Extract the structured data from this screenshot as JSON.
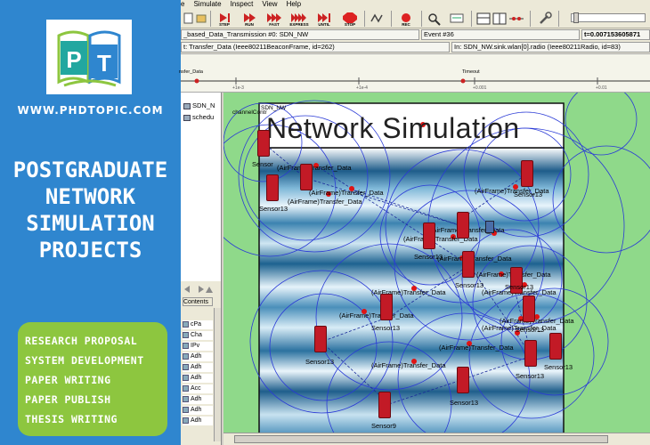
{
  "promo": {
    "logo_text": "PT",
    "website": "WWW.PHDTOPIC.COM",
    "headline": [
      "POSTGRADUATE",
      "NETWORK",
      "SIMULATION",
      "PROJECTS"
    ],
    "services": [
      "RESEARCH PROPOSAL",
      "SYSTEM DEVELOPMENT",
      "PAPER WRITING",
      "PAPER PUBLISH",
      "THESIS WRITING"
    ],
    "colors": {
      "panel": "#2f86cf",
      "services_bg": "#8dc63f",
      "logo_teal": "#22a7a0",
      "logo_blue": "#2f86cf",
      "logo_green": "#8dc63f"
    }
  },
  "menu": [
    "e",
    "Simulate",
    "Inspect",
    "View",
    "Help"
  ],
  "toolbar": {
    "buttons": [
      {
        "label": "STEP",
        "icon": "step-icon"
      },
      {
        "label": "RUN",
        "icon": "run-icon"
      },
      {
        "label": "FAST",
        "icon": "fast-icon"
      },
      {
        "label": "EXPRESS",
        "icon": "express-icon"
      },
      {
        "label": "UNTIL",
        "icon": "until-icon"
      },
      {
        "label": "STOP",
        "icon": "stop-icon"
      },
      {
        "label": "REC",
        "icon": "record-icon"
      }
    ]
  },
  "status": {
    "network": "_based_Data_Transmission #0: SDN_NW",
    "event": "Event #36",
    "time": "t=0.007153605871",
    "msg": "t: Transfer_Data (Ieee80211BeaconFrame, id=262)",
    "module": "In: SDN_NW.sink.wlan[0].radio (Ieee80211Radio, id=83)"
  },
  "timeline": {
    "events": [
      "nsfer_Data",
      "Timeout"
    ],
    "ticks": [
      "+1e-3",
      "+1e-4",
      "+0.001",
      "+0.01"
    ]
  },
  "tree": [
    "SDN_N",
    "schedu"
  ],
  "inspector_list": [
    "Contents",
    "cPa",
    "Cha",
    "IPv",
    "Adh",
    "Adh",
    "Adh",
    "Acc",
    "Adh",
    "Adh",
    "Adh"
  ],
  "canvas": {
    "banner": "Network Simulation",
    "channel_label": "channelContr",
    "sdn_label": "SDN_NW",
    "frame_label": "(AirFrame)Transfer_Data",
    "nodes": [
      {
        "name": "Sensor"
      },
      {
        "name": "Sensor13"
      },
      {
        "name": "Sensor13"
      },
      {
        "name": "Sensor13"
      },
      {
        "name": "Sensor13"
      },
      {
        "name": "Sensor13"
      },
      {
        "name": "Sensor13"
      },
      {
        "name": "Sensor13"
      },
      {
        "name": "Sensor13"
      },
      {
        "name": "Sensor13"
      },
      {
        "name": "Sensor13"
      },
      {
        "name": "Sensor13"
      },
      {
        "name": "Sensor13"
      },
      {
        "name": "Sensor9"
      }
    ]
  }
}
